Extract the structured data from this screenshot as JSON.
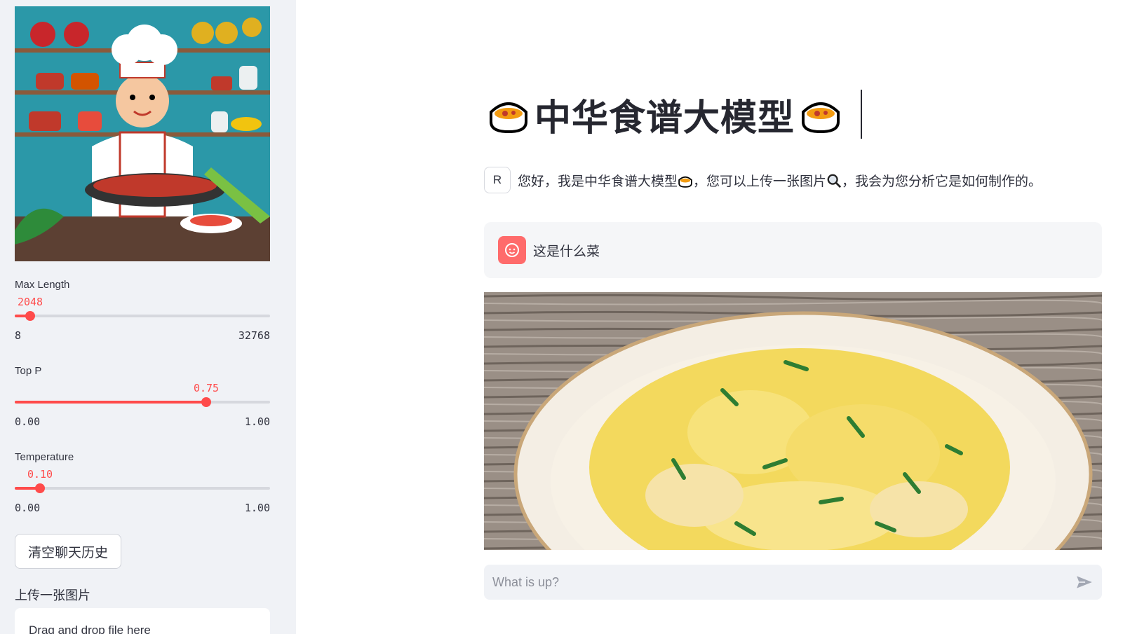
{
  "sidebar": {
    "sliders": [
      {
        "label": "Max Length",
        "value": "2048",
        "min": "8",
        "max": "32768",
        "fraction": 0.062
      },
      {
        "label": "Top P",
        "value": "0.75",
        "min": "0.00",
        "max": "1.00",
        "fraction": 0.75
      },
      {
        "label": "Temperature",
        "value": "0.10",
        "min": "0.00",
        "max": "1.00",
        "fraction": 0.1
      }
    ],
    "clear_button": "清空聊天历史",
    "upload_label": "上传一张图片",
    "dropzone_text": "Drag and drop file here"
  },
  "main": {
    "title": "中华食谱大模型",
    "assistant_message_before": "您好，我是中华食谱大模型",
    "assistant_message_middle": "，您可以上传一张图片",
    "assistant_message_after": "，我会为您分析它是如何制作的。",
    "assistant_avatar": "R",
    "user_message": "这是什么菜",
    "input_placeholder": "What is up?"
  },
  "colors": {
    "accent": "#ff4b4b",
    "sidebar_bg": "#f0f2f6",
    "user_avatar": "#ff6b6b"
  },
  "icons": {
    "title_icon": "cooking-pot-icon",
    "search_icon": "magnifier-icon",
    "send_icon": "send-icon",
    "user_icon": "user-face-icon"
  }
}
